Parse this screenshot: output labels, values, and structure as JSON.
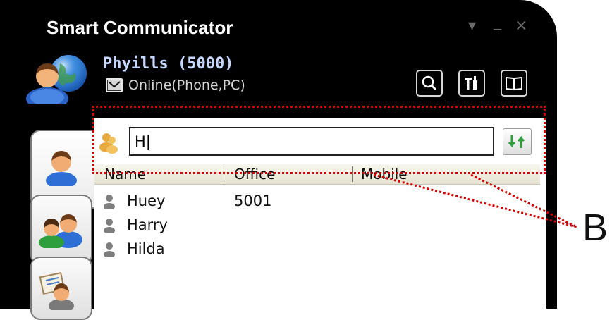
{
  "window": {
    "title": "Smart Communicator",
    "controls": {
      "menu": "▾",
      "minimize": "_",
      "close": "×"
    }
  },
  "user": {
    "name": "Phyills (5000)",
    "status": "Online(Phone,PC)",
    "avatar_icon": "user-globe-avatar-icon"
  },
  "toolbar": {
    "buttons": [
      {
        "name": "search-button",
        "icon": "magnifier-icon"
      },
      {
        "name": "settings-button",
        "icon": "tools-icon"
      },
      {
        "name": "phonebook-button",
        "icon": "book-icon"
      }
    ]
  },
  "sidebar": {
    "tabs": [
      {
        "name": "tab-contacts",
        "icon": "single-user-icon",
        "selected": true
      },
      {
        "name": "tab-groups",
        "icon": "group-users-icon",
        "selected": false
      },
      {
        "name": "tab-presence",
        "icon": "user-board-icon",
        "selected": false
      }
    ]
  },
  "search": {
    "value": "H|",
    "placeholder": "",
    "sort_icon": "sort-down-up-icon"
  },
  "table": {
    "columns": [
      "Name",
      "Office",
      "Mobile"
    ],
    "rows": [
      {
        "name": "Huey",
        "office": "5001",
        "mobile": ""
      },
      {
        "name": "Harry",
        "office": "",
        "mobile": ""
      },
      {
        "name": "Hilda",
        "office": "",
        "mobile": ""
      }
    ]
  },
  "annotation": {
    "label": "B",
    "color": "#d40000"
  },
  "colors": {
    "window_bg": "#000000",
    "username": "#c6d8ff",
    "header_bg": "#efede0"
  }
}
